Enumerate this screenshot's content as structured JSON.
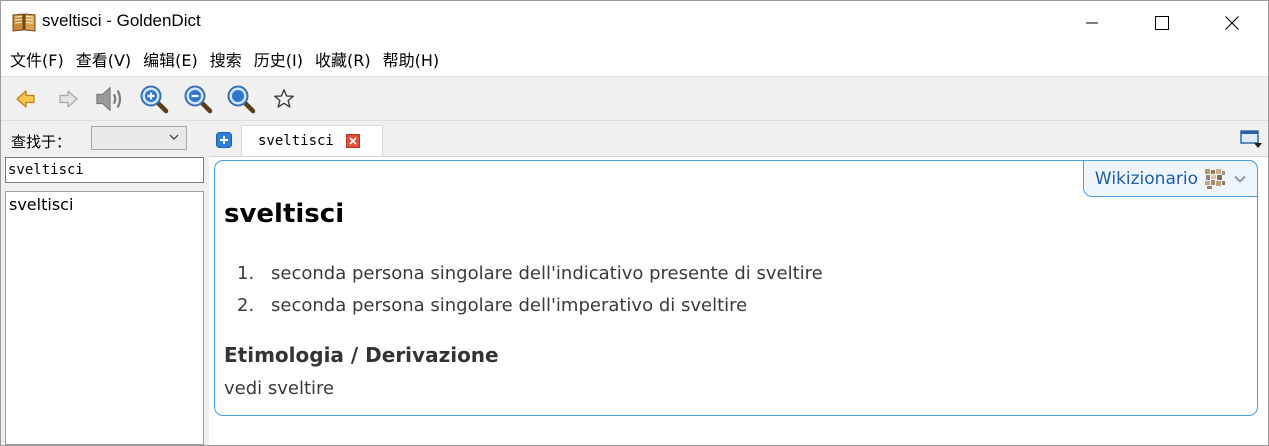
{
  "window": {
    "title": "sveltisci - GoldenDict"
  },
  "menu": [
    {
      "label": "文件(F)",
      "name": "menu-file"
    },
    {
      "label": "查看(V)",
      "name": "menu-view"
    },
    {
      "label": "编辑(E)",
      "name": "menu-edit"
    },
    {
      "label": "搜索",
      "name": "menu-search"
    },
    {
      "label": "历史(I)",
      "name": "menu-history"
    },
    {
      "label": "收藏(R)",
      "name": "menu-favorites"
    },
    {
      "label": "帮助(H)",
      "name": "menu-help"
    }
  ],
  "toolbar": {
    "icons": [
      "back-arrow-icon",
      "forward-arrow-icon",
      "pronounce-speaker-icon",
      "zoom-in-icon",
      "zoom-out-icon",
      "zoom-reset-icon",
      "add-favorite-star-icon"
    ]
  },
  "sidebar": {
    "lookin_label": "查找于：",
    "lookin_value": "",
    "search_value": "sveltisci",
    "results": [
      "sveltisci"
    ]
  },
  "tabs": [
    {
      "label": "sveltisci",
      "active": true
    }
  ],
  "article": {
    "dictionary": "Wikizionario",
    "headword": "sveltisci",
    "definitions": [
      {
        "num": "1.",
        "text": "seconda persona singolare dell'indicativo presente di sveltire"
      },
      {
        "num": "2.",
        "text": "seconda persona singolare dell'imperativo di sveltire"
      }
    ],
    "etymology_heading": "Etimologia / Derivazione",
    "etymology_text": "vedi sveltire"
  },
  "colors": {
    "accent_border": "#4a9ee0",
    "dict_label": "#1c5ea8",
    "tab_close": "#e0513a",
    "tab_add": "#2f7fd6"
  }
}
